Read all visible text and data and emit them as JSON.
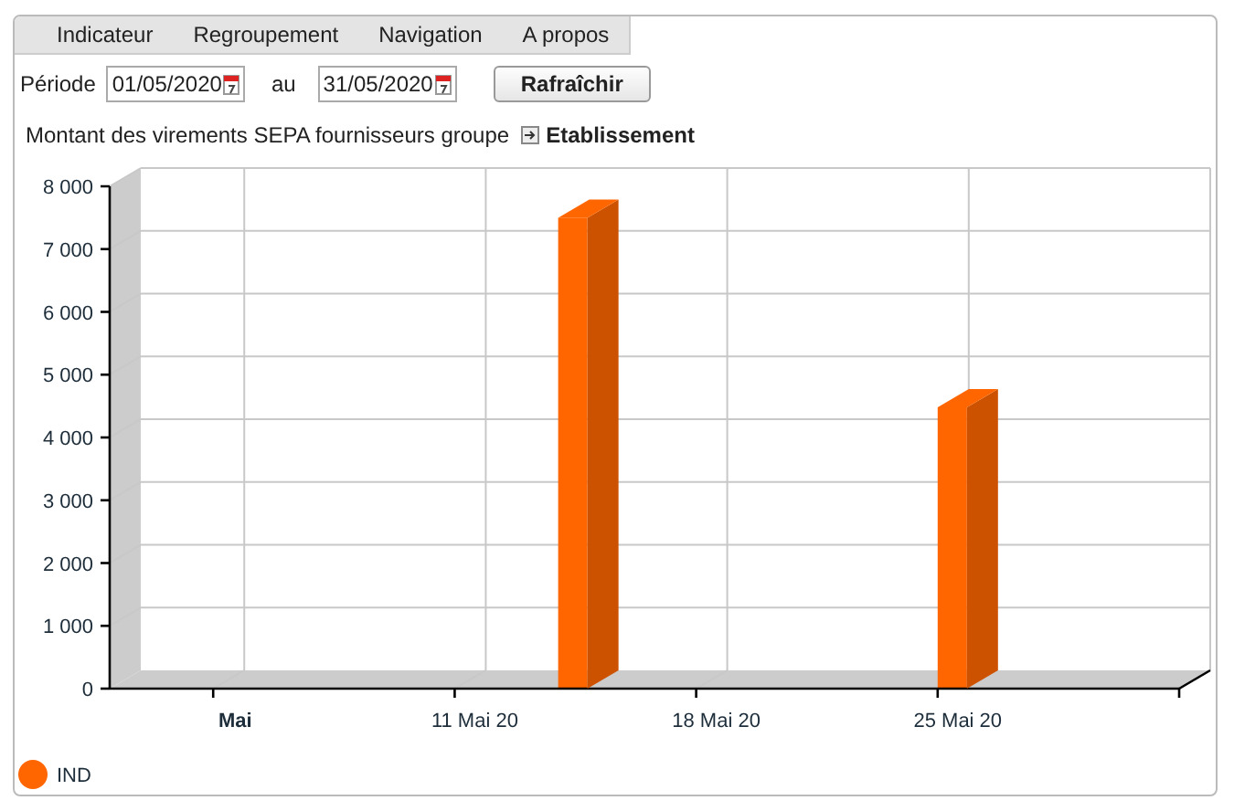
{
  "menu": [
    {
      "label": "Indicateur"
    },
    {
      "label": "Regroupement"
    },
    {
      "label": "Navigation"
    },
    {
      "label": "A propos"
    }
  ],
  "period": {
    "label": "Période",
    "from": "01/05/2020",
    "separator": "au",
    "to": "31/05/2020",
    "refresh": "Rafraîchir"
  },
  "chart_header": {
    "title": "Montant des virements SEPA fournisseurs groupe",
    "link": "Etablissement"
  },
  "chart_data": {
    "type": "bar",
    "categories": [
      null,
      null,
      null,
      "Mai",
      null,
      null,
      null,
      null,
      null,
      null,
      "11 Mai 20",
      null,
      null,
      null,
      null,
      null,
      null,
      "18 Mai 20",
      null,
      null,
      null,
      null,
      null,
      null,
      "25 Mai 20",
      null,
      null,
      null,
      null,
      null,
      null
    ],
    "series": [
      {
        "name": "IND",
        "color": "#ff6600",
        "values": [
          null,
          null,
          null,
          null,
          null,
          null,
          null,
          null,
          null,
          null,
          null,
          null,
          null,
          7500,
          null,
          null,
          null,
          null,
          null,
          null,
          null,
          null,
          null,
          null,
          4480,
          null,
          null,
          null,
          null,
          null,
          null
        ]
      }
    ],
    "ylim": [
      0,
      8000
    ],
    "yticks": [
      {
        "value": 0,
        "label": "0"
      },
      {
        "value": 1000,
        "label": "1 000"
      },
      {
        "value": 2000,
        "label": "2 000"
      },
      {
        "value": 3000,
        "label": "3 000"
      },
      {
        "value": 4000,
        "label": "4 000"
      },
      {
        "value": 5000,
        "label": "5 000"
      },
      {
        "value": 6000,
        "label": "6 000"
      },
      {
        "value": 7000,
        "label": "7 000"
      },
      {
        "value": 8000,
        "label": "8 000"
      }
    ]
  }
}
